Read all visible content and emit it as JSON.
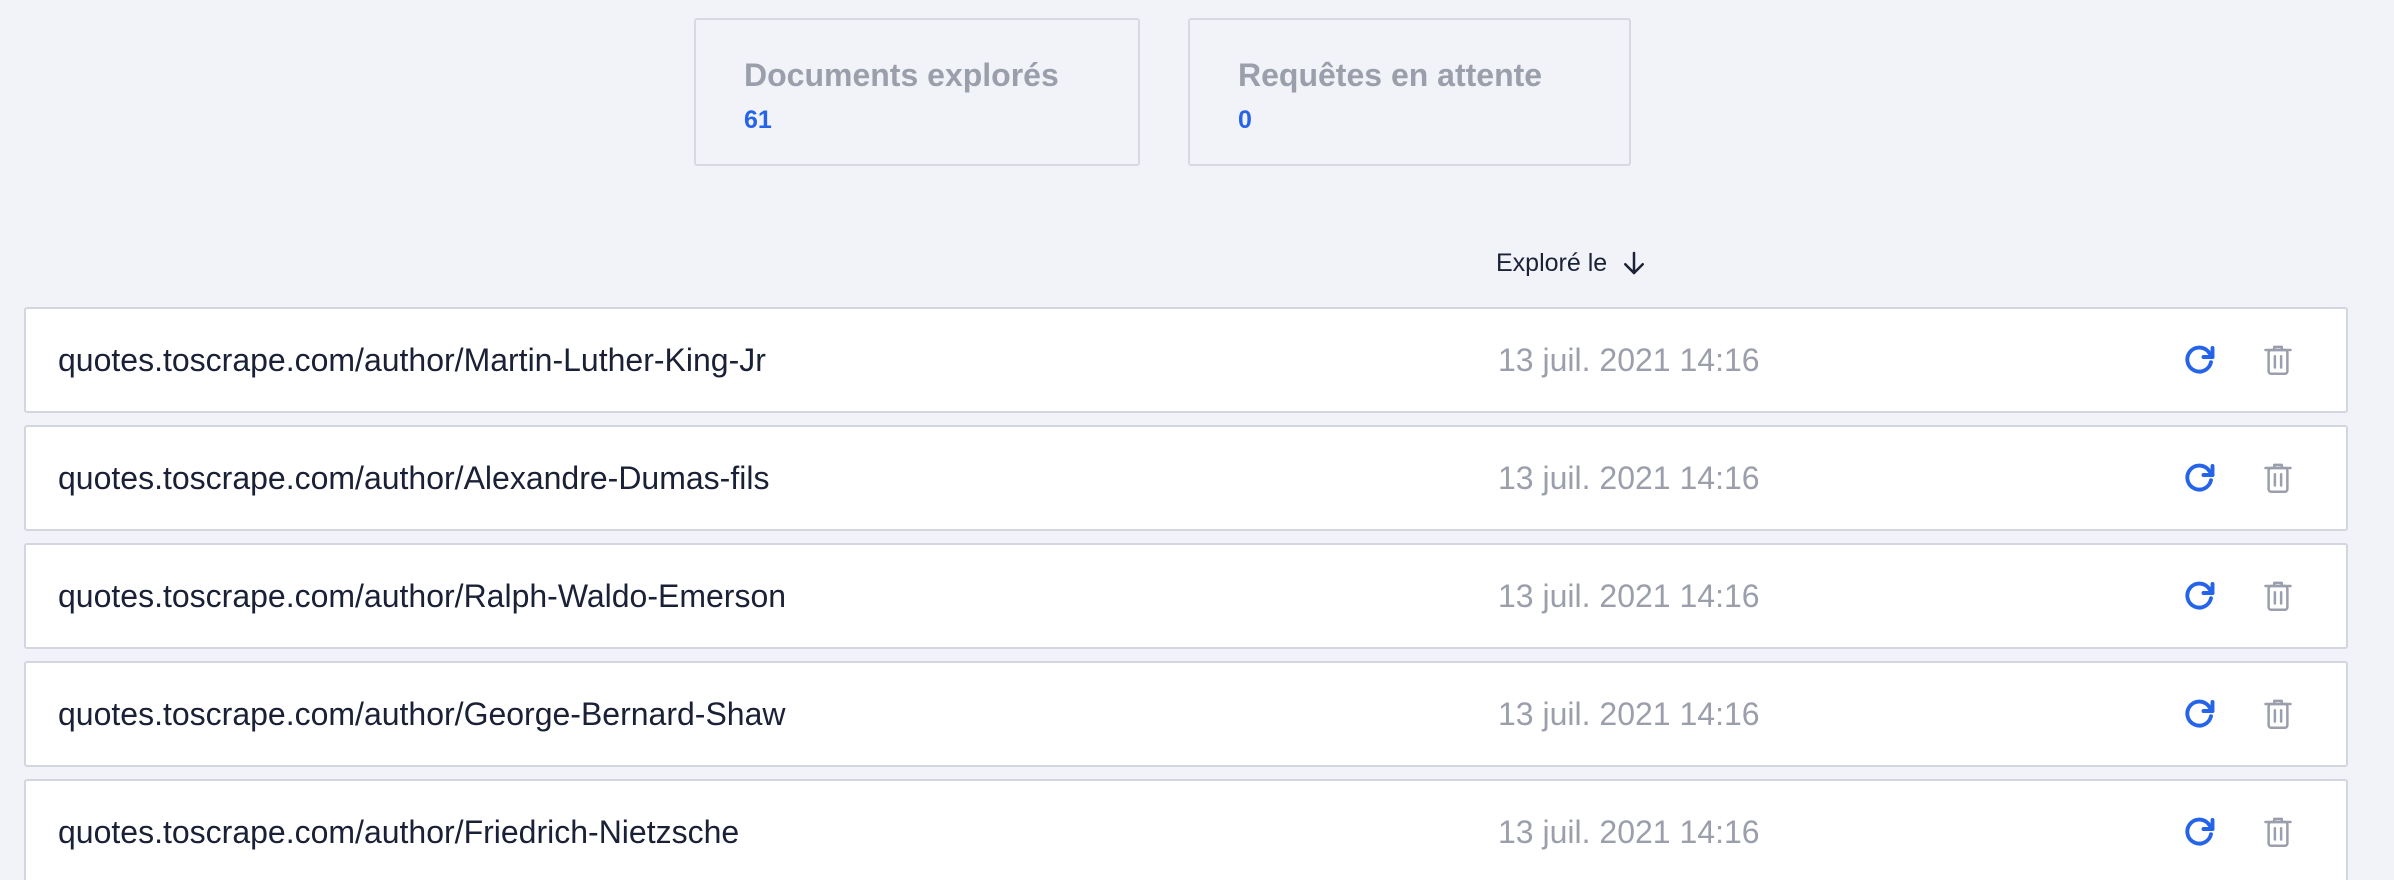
{
  "stats": [
    {
      "label": "Documents explorés",
      "value": "61"
    },
    {
      "label": "Requêtes en attente",
      "value": "0"
    }
  ],
  "table": {
    "sort_label": "Exploré le",
    "rows": [
      {
        "url": "quotes.toscrape.com/author/Martin-Luther-King-Jr",
        "date": "13 juil. 2021 14:16"
      },
      {
        "url": "quotes.toscrape.com/author/Alexandre-Dumas-fils",
        "date": "13 juil. 2021 14:16"
      },
      {
        "url": "quotes.toscrape.com/author/Ralph-Waldo-Emerson",
        "date": "13 juil. 2021 14:16"
      },
      {
        "url": "quotes.toscrape.com/author/George-Bernard-Shaw",
        "date": "13 juil. 2021 14:16"
      },
      {
        "url": "quotes.toscrape.com/author/Friedrich-Nietzsche",
        "date": "13 juil. 2021 14:16"
      }
    ]
  },
  "icons": {
    "sort": "arrow-down-icon",
    "refresh": "refresh-icon",
    "delete": "trash-icon"
  },
  "colors": {
    "accent": "#2563e8",
    "muted_text": "#9a9fab",
    "background": "#f2f3f8"
  }
}
